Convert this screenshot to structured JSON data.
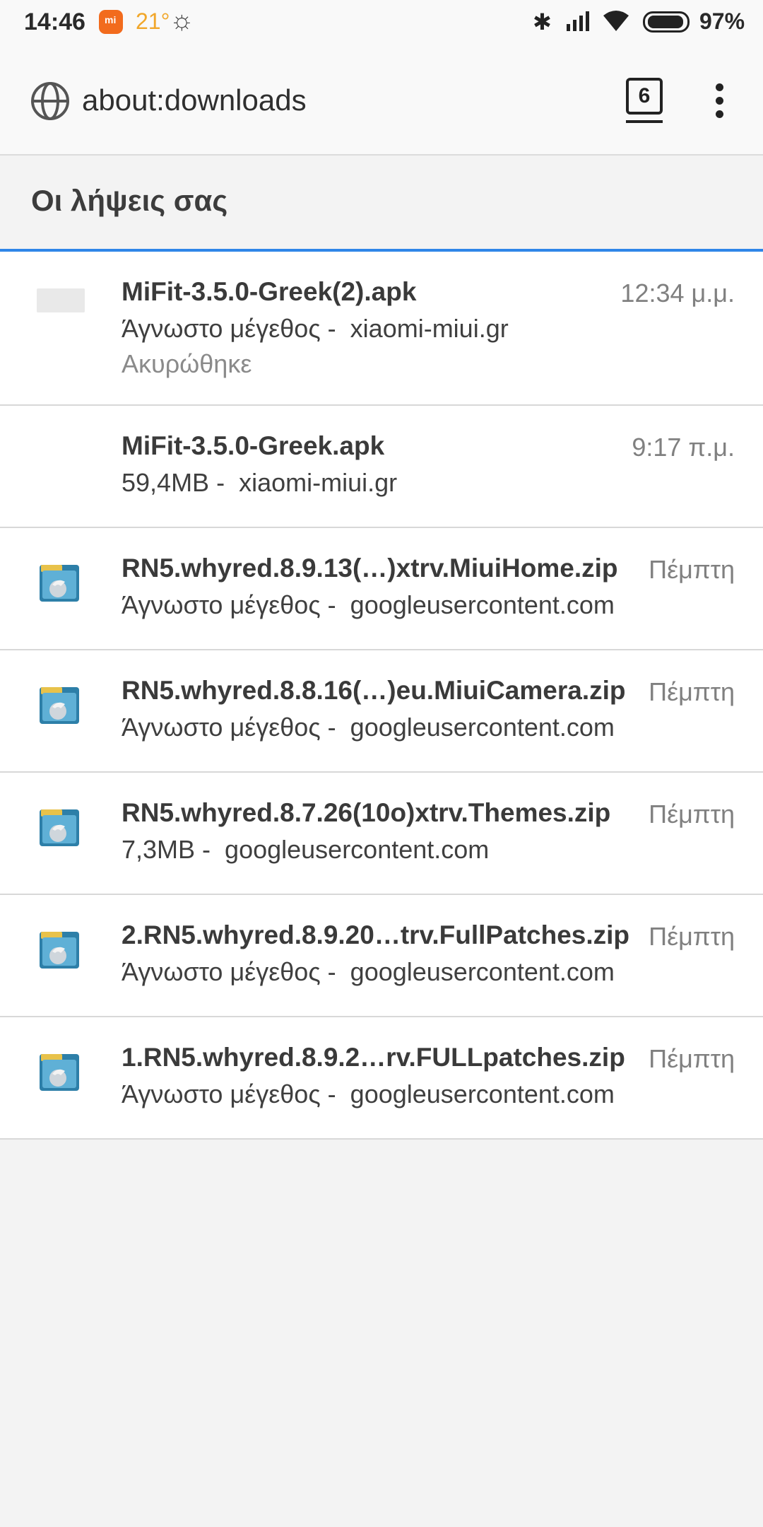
{
  "status_bar": {
    "time": "14:46",
    "temperature": "21°",
    "battery": "97%"
  },
  "toolbar": {
    "url": "about:downloads",
    "tab_count": "6"
  },
  "section": {
    "title": "Οι λήψεις σας"
  },
  "downloads": [
    {
      "name": "MiFit-3.5.0-Greek(2).apk",
      "size": "Άγνωστο μέγεθος",
      "source": "xiaomi-miui.gr",
      "date": "12:34 μ.μ.",
      "status": "Ακυρώθηκε",
      "icon": "blank-file-icon"
    },
    {
      "name": "MiFit-3.5.0-Greek.apk",
      "size": "59,4MB",
      "source": "xiaomi-miui.gr",
      "date": "9:17 π.μ.",
      "status": "",
      "icon": "none"
    },
    {
      "name": "RN5.whyred.8.9.13(…)xtrv.MiuiHome.zip",
      "size": "Άγνωστο μέγεθος",
      "source": "googleusercontent.com",
      "date": "Πέμπτη",
      "status": "",
      "icon": "archive-file-icon"
    },
    {
      "name": "RN5.whyred.8.8.16(…)eu.MiuiCamera.zip",
      "size": "Άγνωστο μέγεθος",
      "source": "googleusercontent.com",
      "date": "Πέμπτη",
      "status": "",
      "icon": "archive-file-icon"
    },
    {
      "name": "RN5.whyred.8.7.26(10o)xtrv.Themes.zip",
      "size": "7,3MB",
      "source": "googleusercontent.com",
      "date": "Πέμπτη",
      "status": "",
      "icon": "archive-file-icon"
    },
    {
      "name": "2.RN5.whyred.8.9.20…trv.FullPatches.zip",
      "size": "Άγνωστο μέγεθος",
      "source": "googleusercontent.com",
      "date": "Πέμπτη",
      "status": "",
      "icon": "archive-file-icon"
    },
    {
      "name": "1.RN5.whyred.8.9.2…rv.FULLpatches.zip",
      "size": "Άγνωστο μέγεθος",
      "source": "googleusercontent.com",
      "date": "Πέμπτη",
      "status": "",
      "icon": "archive-file-icon"
    }
  ],
  "meta_separator": " -  ",
  "colors": {
    "accent": "#2f86e8",
    "mi_brand": "#f26b1d",
    "temperature": "#f1a72b"
  }
}
